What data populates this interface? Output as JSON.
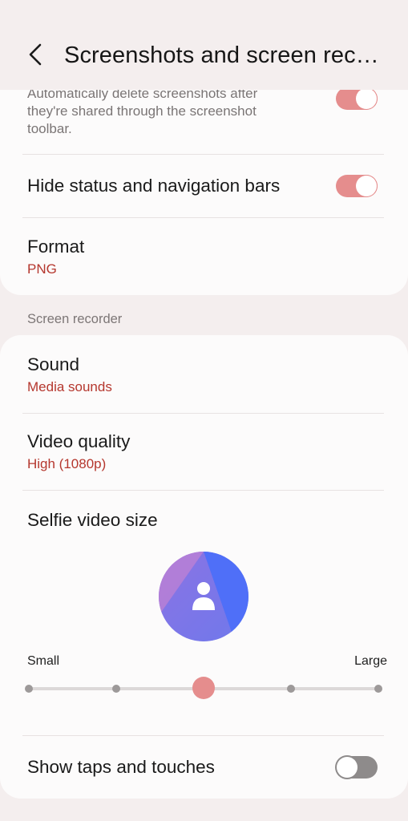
{
  "header": {
    "title": "Screenshots and screen rec…",
    "back_icon": "chevron-left-icon"
  },
  "screenshots_card": {
    "auto_delete_description": "Automatically delete screenshots after they're shared through the screenshot toolbar.",
    "auto_delete_toggle": "on",
    "hide_bars_label": "Hide status and navigation bars",
    "hide_bars_toggle": "on",
    "format_label": "Format",
    "format_value": "PNG"
  },
  "screen_recorder": {
    "section_title": "Screen recorder",
    "sound_label": "Sound",
    "sound_value": "Media sounds",
    "video_quality_label": "Video quality",
    "video_quality_value": "High (1080p)",
    "selfie_size_label": "Selfie video size",
    "selfie_preview_icon": "person-icon",
    "slider": {
      "min_label": "Small",
      "max_label": "Large",
      "steps": 5,
      "selected_step": 3
    },
    "show_taps_label": "Show taps and touches",
    "show_taps_toggle": "off"
  },
  "colors": {
    "accent": "#e58d8d",
    "secondary_text": "#b5372e",
    "background": "#f4eeee",
    "card": "#fcfbfb"
  }
}
